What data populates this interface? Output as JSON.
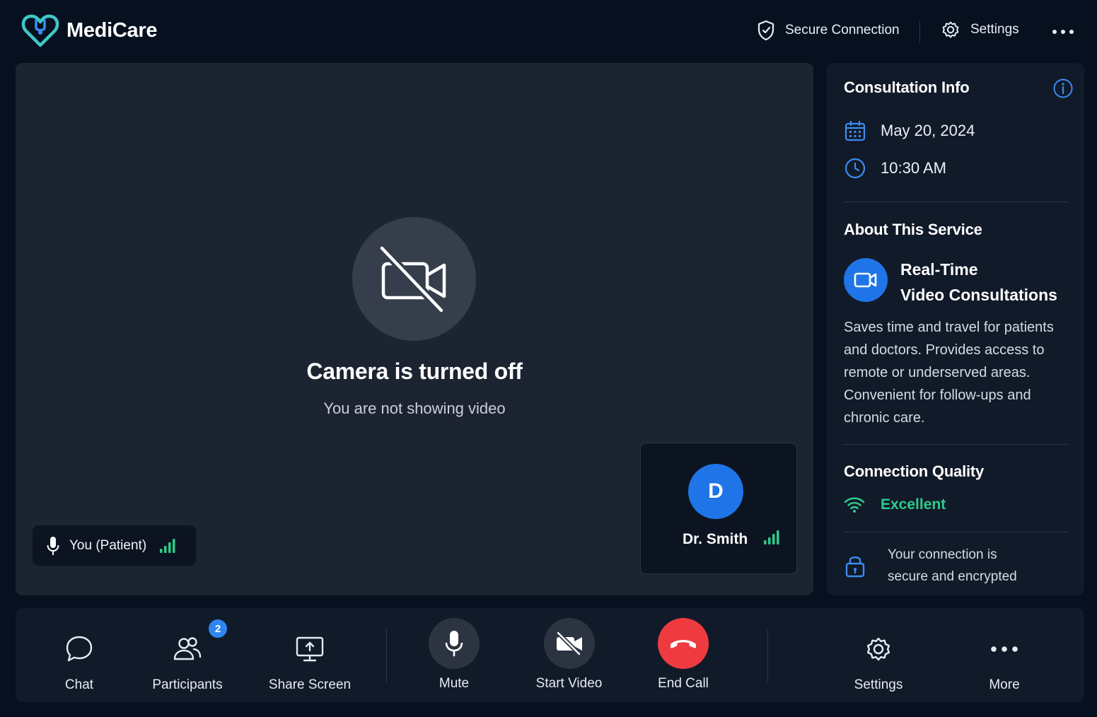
{
  "app": {
    "name": "MediCare"
  },
  "header": {
    "secure_label": "Secure Connection",
    "settings_label": "Settings"
  },
  "stage": {
    "title": "Camera is turned off",
    "subtitle": "You are not showing video",
    "self_label": "You (Patient)",
    "remote": {
      "initial": "D",
      "name": "Dr. Smith"
    }
  },
  "panel": {
    "title": "Consultation Info",
    "date": "May 20, 2024",
    "time": "10:30 AM",
    "about_title": "About This Service",
    "service_title_1": "Real-Time",
    "service_title_2": "Video Consultations",
    "service_desc": "Saves time and travel for patients and doctors. Provides access to remote or underserved areas. Convenient for follow-ups and chronic care.",
    "quality_title": "Connection Quality",
    "quality_value": "Excellent",
    "secure_line_1": "Your connection is",
    "secure_line_2": "secure and encrypted"
  },
  "toolbar": {
    "chat": "Chat",
    "participants": "Participants",
    "participants_count": "2",
    "share": "Share Screen",
    "mute": "Mute",
    "video": "Start Video",
    "end": "End Call",
    "settings": "Settings",
    "more": "More"
  },
  "colors": {
    "background": "#06101f",
    "stage": "#1c2431",
    "panel": "#111a29",
    "accent_blue": "#1f74e8",
    "teal": "#3fc6c6",
    "success_green": "#2dcb8c",
    "end_call_red": "#ef3b40"
  },
  "icons": [
    "heart-logo-icon",
    "shield-icon",
    "gear-icon",
    "more-dots-icon",
    "camera-off-icon",
    "mic-icon",
    "signal-bars-icon",
    "info-icon",
    "calendar-icon",
    "clock-icon",
    "video-camera-icon",
    "wifi-icon",
    "lock-icon",
    "chat-icon",
    "participants-icon",
    "share-screen-icon",
    "phone-hangup-icon"
  ]
}
